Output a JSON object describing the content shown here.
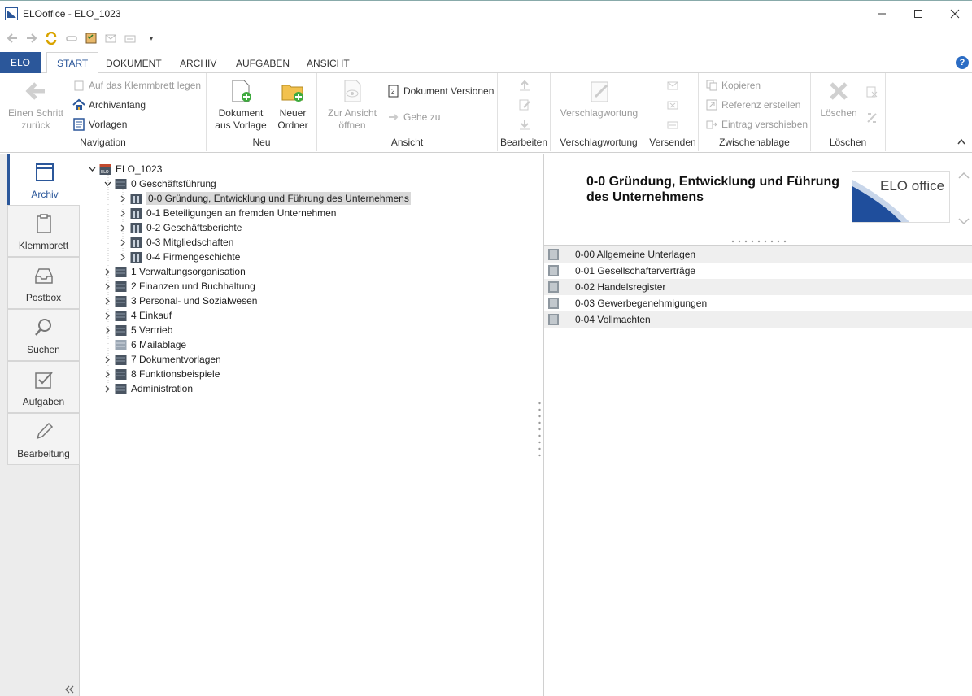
{
  "window": {
    "app_name": "ELOoffice",
    "title": "ELOoffice  -  ELO_1023"
  },
  "ribbon_tabs": {
    "elo": "ELO",
    "start": "START",
    "dokument": "DOKUMENT",
    "archiv": "ARCHIV",
    "aufgaben": "AUFGABEN",
    "ansicht": "ANSICHT"
  },
  "ribbon": {
    "navigation": {
      "label": "Navigation",
      "back": "Einen Schritt zurück",
      "clipboard": "Auf das Klemmbrett legen",
      "archive_start": "Archivanfang",
      "templates": "Vorlagen"
    },
    "neu": {
      "label": "Neu",
      "doc_from_template": "Dokument aus Vorlage",
      "new_folder": "Neuer Ordner"
    },
    "ansicht": {
      "label": "Ansicht",
      "to_view": "Zur Ansicht öffnen",
      "doc_versions": "Dokument Versionen",
      "goto": "Gehe zu"
    },
    "bearbeiten": {
      "label": "Bearbeiten"
    },
    "verschlagwortung": {
      "label": "Verschlagwortung",
      "button": "Verschlagwortung"
    },
    "versenden": {
      "label": "Versenden"
    },
    "zwischenablage": {
      "label": "Zwischenablage",
      "copy": "Kopieren",
      "create_reference": "Referenz erstellen",
      "move_entry": "Eintrag verschieben"
    },
    "loeschen": {
      "label": "Löschen",
      "button": "Löschen"
    }
  },
  "leftnav": [
    {
      "label": "Archiv",
      "icon": "archive-icon"
    },
    {
      "label": "Klemmbrett",
      "icon": "clipboard-icon"
    },
    {
      "label": "Postbox",
      "icon": "inbox-icon"
    },
    {
      "label": "Suchen",
      "icon": "search-icon"
    },
    {
      "label": "Aufgaben",
      "icon": "checkbox-icon"
    },
    {
      "label": "Bearbeitung",
      "icon": "pencil-icon"
    }
  ],
  "tree": {
    "root": "ELO_1023",
    "items": [
      {
        "label": "0 Geschäftsführung"
      },
      {
        "label": "0-0 Gründung, Entwicklung und Führung des Unternehmens"
      },
      {
        "label": "0-1 Beteiligungen an fremden Unternehmen"
      },
      {
        "label": "0-2 Geschäftsberichte"
      },
      {
        "label": "0-3 Mitgliedschaften"
      },
      {
        "label": "0-4 Firmengeschichte"
      },
      {
        "label": "1 Verwaltungsorganisation"
      },
      {
        "label": "2 Finanzen und Buchhaltung"
      },
      {
        "label": "3 Personal- und Sozialwesen"
      },
      {
        "label": "4 Einkauf"
      },
      {
        "label": "5 Vertrieb"
      },
      {
        "label": "6 Mailablage"
      },
      {
        "label": "7 Dokumentvorlagen"
      },
      {
        "label": "8 Funktionsbeispiele"
      },
      {
        "label": "Administration"
      }
    ]
  },
  "preview": {
    "title": "0-0 Gründung, Entwicklung und Führung des Unternehmens",
    "logo_text": "ELO office"
  },
  "content_list": [
    {
      "label": "0-00 Allgemeine Unterlagen"
    },
    {
      "label": "0-01 Gesellschafterverträge"
    },
    {
      "label": "0-02 Handelsregister"
    },
    {
      "label": "0-03 Gewerbegenehmigungen"
    },
    {
      "label": "0-04 Vollmachten"
    }
  ],
  "colors": {
    "accent": "#2b579a",
    "selection": "#d9d9d9",
    "folder_dark": "#4a5562"
  }
}
